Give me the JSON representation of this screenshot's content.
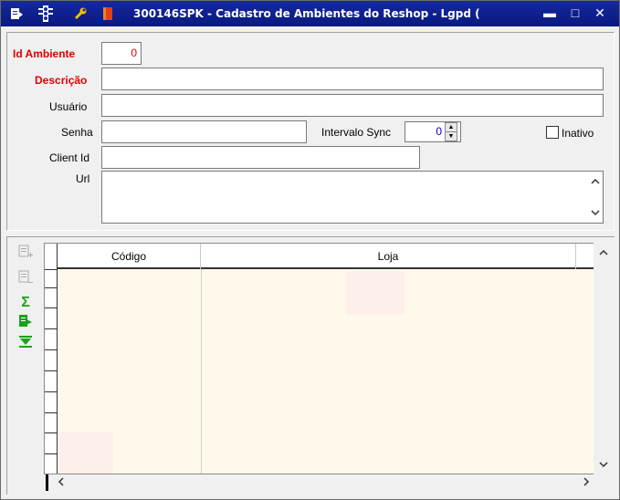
{
  "titlebar": {
    "title": "300146SPK - Cadastro de Ambientes do Reshop - Lgpd (",
    "icons": [
      "menu-icon",
      "traffic-light-icon",
      "wrench-icon",
      "book-icon"
    ],
    "minimize": "▬",
    "maximize": "□",
    "close": "✕"
  },
  "form": {
    "id_ambiente_label": "Id Ambiente",
    "id_ambiente_value": "0",
    "descricao_label": "Descrição",
    "descricao_value": "",
    "usuario_label": "Usuário",
    "usuario_value": "",
    "senha_label": "Senha",
    "senha_value": "",
    "intervalo_label": "Intervalo Sync",
    "intervalo_value": "0",
    "inativo_label": "Inativo",
    "client_id_label": "Client Id",
    "client_id_value": "",
    "url_label": "Url",
    "url_value": ""
  },
  "grid": {
    "columns": [
      {
        "label": "Código"
      },
      {
        "label": "Loja"
      }
    ]
  },
  "colors": {
    "titlebar": "#0b1a8c",
    "required_label": "#e00000",
    "grid_background": "#fff9ec"
  }
}
